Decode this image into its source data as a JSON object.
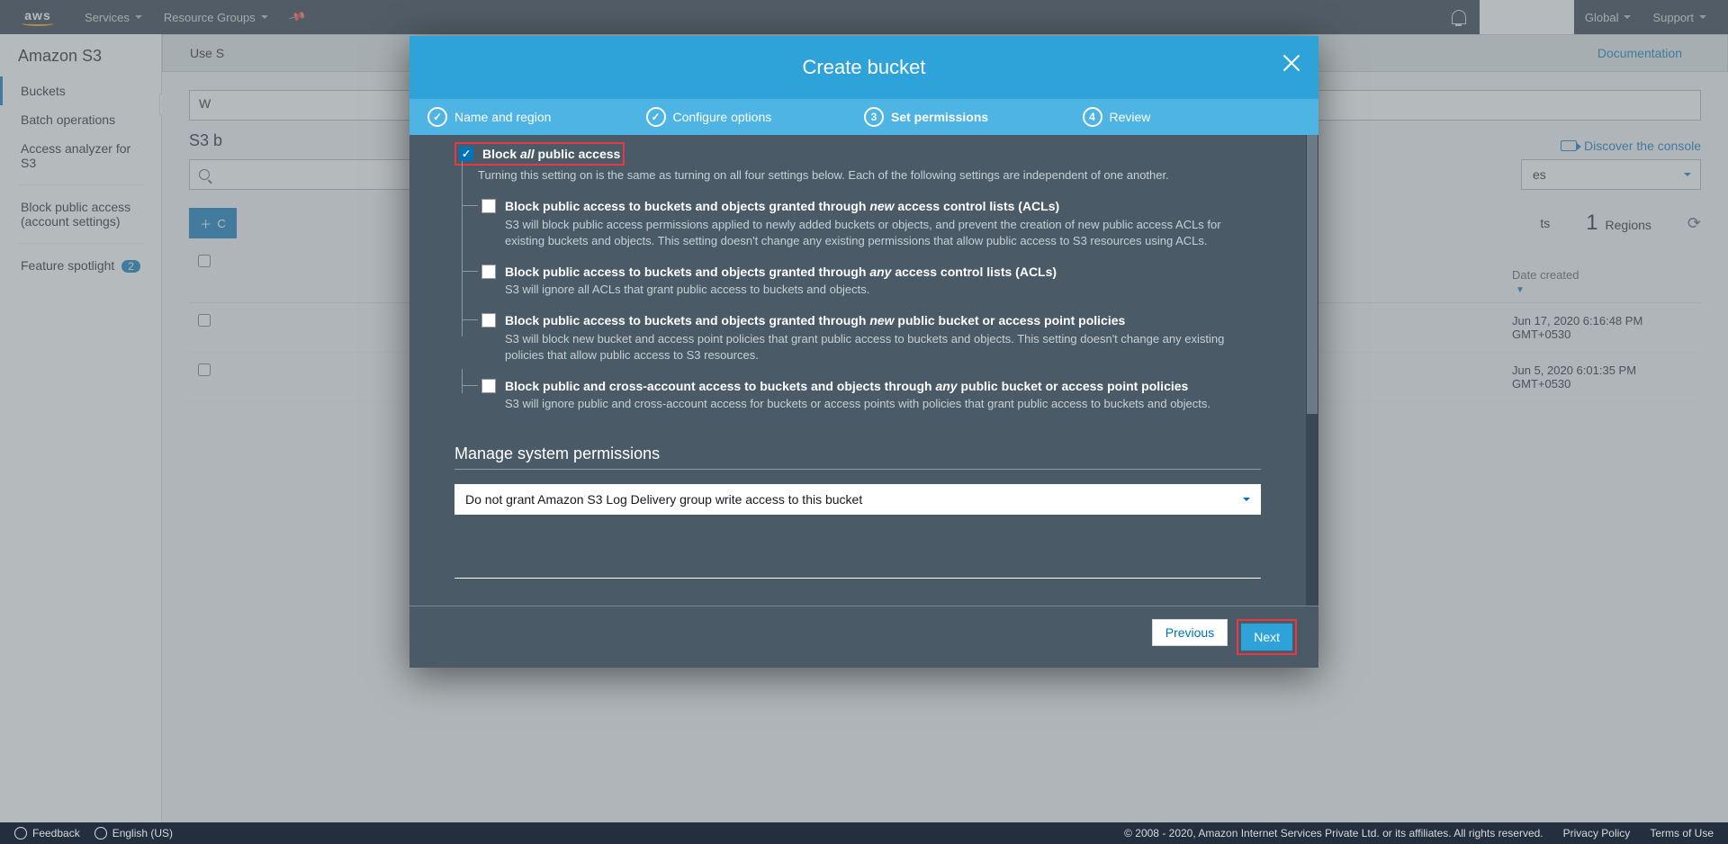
{
  "nav": {
    "services": "Services",
    "resourceGroups": "Resource Groups",
    "global": "Global",
    "support": "Support"
  },
  "sidebar": {
    "title": "Amazon S3",
    "buckets": "Buckets",
    "batch": "Batch operations",
    "analyzer": "Access analyzer for S3",
    "block": "Block public access (account settings)",
    "feature": "Feature spotlight",
    "featureBadge": "2"
  },
  "banner": {
    "text": "Use S",
    "doc": "Documentation"
  },
  "page": {
    "title": "S3 b",
    "searchPlaceholder": "W",
    "discover": "Discover the console",
    "dateHeader": "Date created",
    "regionsCount": "1",
    "regionsLabel": "Regions",
    "resLabel": "ts",
    "rows": [
      {
        "date": "Jun 17, 2020 6:16:48 PM GMT+0530"
      },
      {
        "date": "Jun 5, 2020 6:01:35 PM GMT+0530"
      }
    ],
    "selectTypes": "es"
  },
  "modal": {
    "title": "Create bucket",
    "steps": {
      "s1": "Name and region",
      "s2": "Configure options",
      "s3": "Set permissions",
      "s4": "Review"
    },
    "block": {
      "main_pre": "Block ",
      "main_em": "all",
      "main_post": " public access",
      "main_desc": "Turning this setting on is the same as turning on all four settings below. Each of the following settings are independent of one another.",
      "b1_pre": "Block public access to buckets and objects granted through ",
      "b1_em": "new",
      "b1_post": " access control lists (ACLs)",
      "b1_desc": "S3 will block public access permissions applied to newly added buckets or objects, and prevent the creation of new public access ACLs for existing buckets and objects. This setting doesn't change any existing permissions that allow public access to S3 resources using ACLs.",
      "b2_pre": "Block public access to buckets and objects granted through ",
      "b2_em": "any",
      "b2_post": " access control lists (ACLs)",
      "b2_desc": "S3 will ignore all ACLs that grant public access to buckets and objects.",
      "b3_pre": "Block public access to buckets and objects granted through ",
      "b3_em": "new",
      "b3_post": " public bucket or access point policies",
      "b3_desc": "S3 will block new bucket and access point policies that grant public access to buckets and objects. This setting doesn't change any existing policies that allow public access to S3 resources.",
      "b4_pre": "Block public and cross-account access to buckets and objects through ",
      "b4_em": "any",
      "b4_post": " public bucket or access point policies",
      "b4_desc": "S3 will ignore public and cross-account access for buckets or access points with policies that grant public access to buckets and objects."
    },
    "manage": {
      "title": "Manage system permissions",
      "select": "Do not grant Amazon S3 Log Delivery group write access to this bucket"
    },
    "prev": "Previous",
    "next": "Next"
  },
  "footer": {
    "feedback": "Feedback",
    "lang": "English (US)",
    "copyright": "© 2008 - 2020, Amazon Internet Services Private Ltd. or its affiliates. All rights reserved.",
    "privacy": "Privacy Policy",
    "terms": "Terms of Use"
  }
}
